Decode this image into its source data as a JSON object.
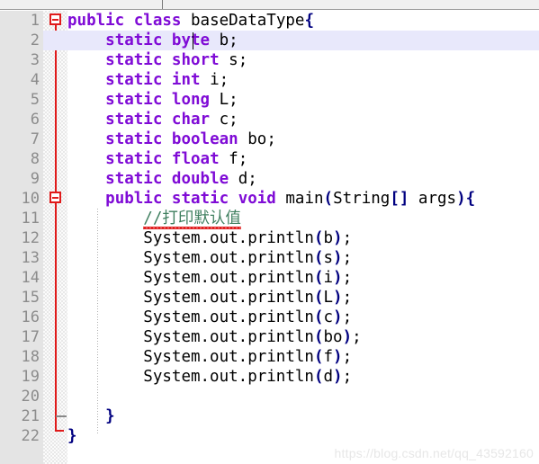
{
  "editor": {
    "language": "Java",
    "file_class": "baseDataType",
    "current_line": 2,
    "total_lines": 22,
    "colors": {
      "keyword": "#7f0bd6",
      "identifier": "#000000",
      "punctuation": "#000080",
      "comment": "#3f7f5f",
      "gutter_bg": "#e4e4e4",
      "gutter_text": "#8c8c8c",
      "current_line_bg": "#e8e8fb",
      "fold_marker": "#e01b1b",
      "spell_error": "#e02020",
      "watermark": "#e7e7e7",
      "editor_bg": "#ffffff",
      "toolbar_bg": "#f0f0f0"
    }
  },
  "toolbar": {
    "divider_label": ""
  },
  "gutter": {
    "line_numbers": [
      "1",
      "2",
      "3",
      "4",
      "5",
      "6",
      "7",
      "8",
      "9",
      "10",
      "11",
      "12",
      "13",
      "14",
      "15",
      "16",
      "17",
      "18",
      "19",
      "20",
      "21",
      "22"
    ]
  },
  "fold_markers": [
    {
      "line": 1,
      "type": "collapse-box",
      "label": "-"
    },
    {
      "line": 10,
      "type": "collapse-box",
      "label": "-"
    },
    {
      "line": 21,
      "type": "fold-end-tick"
    },
    {
      "line": 22,
      "type": "fold-end-foot"
    }
  ],
  "lines": [
    {
      "n": 1,
      "indent": 0,
      "tokens": [
        {
          "t": "public",
          "c": "kw"
        },
        {
          "t": " ",
          "c": "plain"
        },
        {
          "t": "class",
          "c": "kw"
        },
        {
          "t": " ",
          "c": "plain"
        },
        {
          "t": "baseDataType",
          "c": "id"
        },
        {
          "t": "{",
          "c": "punct"
        }
      ]
    },
    {
      "n": 2,
      "indent": 1,
      "tokens": [
        {
          "t": "static",
          "c": "kw"
        },
        {
          "t": " ",
          "c": "plain"
        },
        {
          "t": "byte",
          "c": "kw"
        },
        {
          "t": " ",
          "c": "plain"
        },
        {
          "t": "b",
          "c": "id"
        },
        {
          "t": ";",
          "c": "plain"
        }
      ]
    },
    {
      "n": 3,
      "indent": 1,
      "tokens": [
        {
          "t": "static",
          "c": "kw"
        },
        {
          "t": " ",
          "c": "plain"
        },
        {
          "t": "short",
          "c": "kw"
        },
        {
          "t": " ",
          "c": "plain"
        },
        {
          "t": "s",
          "c": "id"
        },
        {
          "t": ";",
          "c": "plain"
        }
      ]
    },
    {
      "n": 4,
      "indent": 1,
      "tokens": [
        {
          "t": "static",
          "c": "kw"
        },
        {
          "t": " ",
          "c": "plain"
        },
        {
          "t": "int",
          "c": "kw"
        },
        {
          "t": " ",
          "c": "plain"
        },
        {
          "t": "i",
          "c": "id"
        },
        {
          "t": ";",
          "c": "plain"
        }
      ]
    },
    {
      "n": 5,
      "indent": 1,
      "tokens": [
        {
          "t": "static",
          "c": "kw"
        },
        {
          "t": " ",
          "c": "plain"
        },
        {
          "t": "long",
          "c": "kw"
        },
        {
          "t": " ",
          "c": "plain"
        },
        {
          "t": "L",
          "c": "id"
        },
        {
          "t": ";",
          "c": "plain"
        }
      ]
    },
    {
      "n": 6,
      "indent": 1,
      "tokens": [
        {
          "t": "static",
          "c": "kw"
        },
        {
          "t": " ",
          "c": "plain"
        },
        {
          "t": "char",
          "c": "kw"
        },
        {
          "t": " ",
          "c": "plain"
        },
        {
          "t": "c",
          "c": "id"
        },
        {
          "t": ";",
          "c": "plain"
        }
      ]
    },
    {
      "n": 7,
      "indent": 1,
      "tokens": [
        {
          "t": "static",
          "c": "kw"
        },
        {
          "t": " ",
          "c": "plain"
        },
        {
          "t": "boolean",
          "c": "kw"
        },
        {
          "t": " ",
          "c": "plain"
        },
        {
          "t": "bo",
          "c": "id"
        },
        {
          "t": ";",
          "c": "plain"
        }
      ]
    },
    {
      "n": 8,
      "indent": 1,
      "tokens": [
        {
          "t": "static",
          "c": "kw"
        },
        {
          "t": " ",
          "c": "plain"
        },
        {
          "t": "float",
          "c": "kw"
        },
        {
          "t": " ",
          "c": "plain"
        },
        {
          "t": "f",
          "c": "id"
        },
        {
          "t": ";",
          "c": "plain"
        }
      ]
    },
    {
      "n": 9,
      "indent": 1,
      "tokens": [
        {
          "t": "static",
          "c": "kw"
        },
        {
          "t": " ",
          "c": "plain"
        },
        {
          "t": "double",
          "c": "kw"
        },
        {
          "t": " ",
          "c": "plain"
        },
        {
          "t": "d",
          "c": "id"
        },
        {
          "t": ";",
          "c": "plain"
        }
      ]
    },
    {
      "n": 10,
      "indent": 1,
      "tokens": [
        {
          "t": "public",
          "c": "kw"
        },
        {
          "t": " ",
          "c": "plain"
        },
        {
          "t": "static",
          "c": "kw"
        },
        {
          "t": " ",
          "c": "plain"
        },
        {
          "t": "void",
          "c": "kw"
        },
        {
          "t": " ",
          "c": "plain"
        },
        {
          "t": "main",
          "c": "id"
        },
        {
          "t": "(",
          "c": "punct"
        },
        {
          "t": "String",
          "c": "id"
        },
        {
          "t": "[]",
          "c": "punct"
        },
        {
          "t": " args",
          "c": "id"
        },
        {
          "t": ")",
          "c": "punct"
        },
        {
          "t": "{",
          "c": "punct"
        }
      ]
    },
    {
      "n": 11,
      "indent": 2,
      "tokens": [
        {
          "t": "//打印默认值",
          "c": "cmt",
          "squiggle": true
        }
      ]
    },
    {
      "n": 12,
      "indent": 2,
      "tokens": [
        {
          "t": "System.out.println",
          "c": "id"
        },
        {
          "t": "(",
          "c": "punct"
        },
        {
          "t": "b",
          "c": "id"
        },
        {
          "t": ")",
          "c": "punct"
        },
        {
          "t": ";",
          "c": "plain"
        }
      ]
    },
    {
      "n": 13,
      "indent": 2,
      "tokens": [
        {
          "t": "System.out.println",
          "c": "id"
        },
        {
          "t": "(",
          "c": "punct"
        },
        {
          "t": "s",
          "c": "id"
        },
        {
          "t": ")",
          "c": "punct"
        },
        {
          "t": ";",
          "c": "plain"
        }
      ]
    },
    {
      "n": 14,
      "indent": 2,
      "tokens": [
        {
          "t": "System.out.println",
          "c": "id"
        },
        {
          "t": "(",
          "c": "punct"
        },
        {
          "t": "i",
          "c": "id"
        },
        {
          "t": ")",
          "c": "punct"
        },
        {
          "t": ";",
          "c": "plain"
        }
      ]
    },
    {
      "n": 15,
      "indent": 2,
      "tokens": [
        {
          "t": "System.out.println",
          "c": "id"
        },
        {
          "t": "(",
          "c": "punct"
        },
        {
          "t": "L",
          "c": "id"
        },
        {
          "t": ")",
          "c": "punct"
        },
        {
          "t": ";",
          "c": "plain"
        }
      ]
    },
    {
      "n": 16,
      "indent": 2,
      "tokens": [
        {
          "t": "System.out.println",
          "c": "id"
        },
        {
          "t": "(",
          "c": "punct"
        },
        {
          "t": "c",
          "c": "id"
        },
        {
          "t": ")",
          "c": "punct"
        },
        {
          "t": ";",
          "c": "plain"
        }
      ]
    },
    {
      "n": 17,
      "indent": 2,
      "tokens": [
        {
          "t": "System.out.println",
          "c": "id"
        },
        {
          "t": "(",
          "c": "punct"
        },
        {
          "t": "bo",
          "c": "id"
        },
        {
          "t": ")",
          "c": "punct"
        },
        {
          "t": ";",
          "c": "plain"
        }
      ]
    },
    {
      "n": 18,
      "indent": 2,
      "tokens": [
        {
          "t": "System.out.println",
          "c": "id"
        },
        {
          "t": "(",
          "c": "punct"
        },
        {
          "t": "f",
          "c": "id"
        },
        {
          "t": ")",
          "c": "punct"
        },
        {
          "t": ";",
          "c": "plain"
        }
      ]
    },
    {
      "n": 19,
      "indent": 2,
      "tokens": [
        {
          "t": "System.out.println",
          "c": "id"
        },
        {
          "t": "(",
          "c": "punct"
        },
        {
          "t": "d",
          "c": "id"
        },
        {
          "t": ")",
          "c": "punct"
        },
        {
          "t": ";",
          "c": "plain"
        }
      ]
    },
    {
      "n": 20,
      "indent": 0,
      "tokens": []
    },
    {
      "n": 21,
      "indent": 1,
      "tokens": [
        {
          "t": "}",
          "c": "punct"
        }
      ]
    },
    {
      "n": 22,
      "indent": 0,
      "tokens": [
        {
          "t": "}",
          "c": "punct"
        }
      ]
    }
  ],
  "watermark": {
    "text": "https://blog.csdn.net/qq_43592160"
  }
}
